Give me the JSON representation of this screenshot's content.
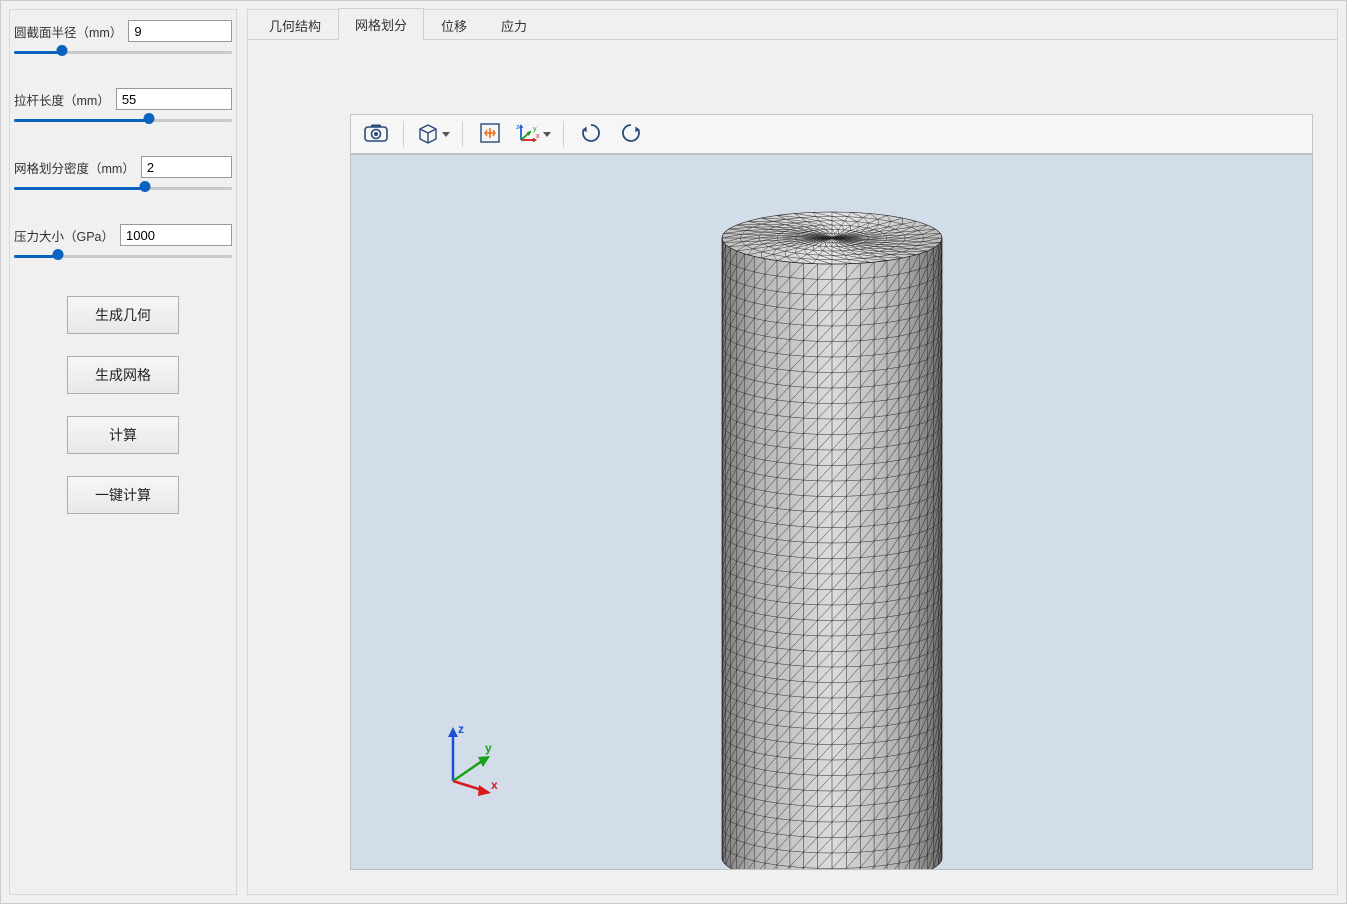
{
  "sidebar": {
    "params": {
      "radius": {
        "label": "圆截面半径（mm）",
        "value": "9",
        "slider_pct": 22
      },
      "length": {
        "label": "拉杆长度（mm）",
        "value": "55",
        "slider_pct": 62
      },
      "mesh": {
        "label": "网格划分密度（mm）",
        "value": "2",
        "slider_pct": 60
      },
      "pressure": {
        "label": "压力大小（GPa）",
        "value": "1000",
        "slider_pct": 20
      }
    },
    "buttons": {
      "gen_geom": "生成几何",
      "gen_mesh": "生成网格",
      "compute": "计算",
      "one_click": "一键计算"
    }
  },
  "tabs": {
    "items": [
      {
        "id": "geom",
        "label": "几何结构"
      },
      {
        "id": "mesh",
        "label": "网格划分"
      },
      {
        "id": "disp",
        "label": "位移"
      },
      {
        "id": "stress",
        "label": "应力"
      }
    ],
    "active": "mesh"
  },
  "toolbar": {
    "icons": {
      "snapshot": "camera-icon",
      "view_cube": "cube-icon",
      "fit": "fit-to-window-icon",
      "axes": "xyz-axes-icon",
      "rotate_cw": "rotate-cw-icon",
      "rotate_ccw": "rotate-ccw-icon"
    }
  },
  "triad": {
    "x": "x",
    "y": "y",
    "z": "z"
  }
}
